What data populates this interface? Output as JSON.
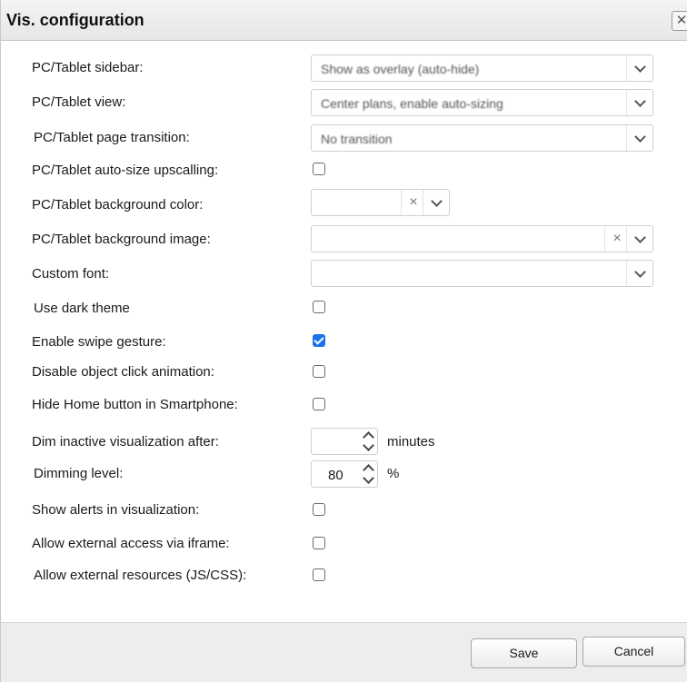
{
  "dialog": {
    "title": "Vis. configuration",
    "close_glyph": "✕"
  },
  "settings": {
    "sidebar": {
      "label": "PC/Tablet sidebar:",
      "value": "Show as overlay (auto-hide)"
    },
    "view": {
      "label": "PC/Tablet view:",
      "value": "Center plans, enable auto-sizing"
    },
    "page_transition": {
      "label": "PC/Tablet page transition:",
      "value": "No transition"
    },
    "auto_size_upscaling": {
      "label": "PC/Tablet auto-size upscalling:",
      "checked": false
    },
    "background_color": {
      "label": "PC/Tablet background color:",
      "value": ""
    },
    "background_image": {
      "label": "PC/Tablet background image:",
      "value": ""
    },
    "custom_font": {
      "label": "Custom font:",
      "value": ""
    },
    "dark_theme": {
      "label": "Use dark theme",
      "checked": false
    },
    "swipe_gesture": {
      "label": "Enable swipe gesture:",
      "checked": true
    },
    "disable_click_animation": {
      "label": "Disable object click animation:",
      "checked": false
    },
    "hide_home_button": {
      "label": "Hide Home button in Smartphone:",
      "checked": false
    },
    "dim_inactive": {
      "label": "Dim inactive visualization after:",
      "value": "",
      "unit": "minutes"
    },
    "dimming_level": {
      "label": "Dimming level:",
      "value": "80",
      "unit": "%"
    },
    "show_alerts": {
      "label": "Show alerts in visualization:",
      "checked": false
    },
    "external_iframe": {
      "label": "Allow external access via iframe:",
      "checked": false
    },
    "external_resources": {
      "label": "Allow external resources (JS/CSS):",
      "checked": false
    }
  },
  "footer": {
    "save_label": "Save",
    "cancel_label": "Cancel"
  },
  "icons": {
    "clear": "×"
  },
  "colors": {
    "accent": "#1a73e8",
    "footer_bg": "#ededed"
  }
}
